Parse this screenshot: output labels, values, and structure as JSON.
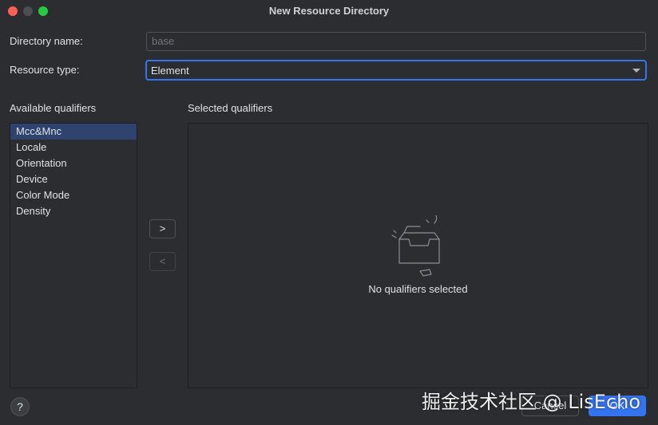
{
  "window": {
    "title": "New Resource Directory"
  },
  "form": {
    "directory_name_label": "Directory name:",
    "directory_name_value": "base",
    "resource_type_label": "Resource type:",
    "resource_type_value": "Element"
  },
  "available": {
    "header": "Available qualifiers",
    "items": [
      "Mcc&Mnc",
      "Locale",
      "Orientation",
      "Device",
      "Color Mode",
      "Density"
    ],
    "selected_index": 0
  },
  "selected": {
    "header": "Selected qualifiers",
    "empty_text": "No qualifiers selected"
  },
  "transfer": {
    "add_label": ">",
    "remove_label": "<"
  },
  "footer": {
    "help_label": "?",
    "cancel_label": "Cancel",
    "ok_label": "OK"
  },
  "watermark": "掘金技术社区 @ LisEcho",
  "colors": {
    "accent": "#3574f0",
    "background": "#2b2d30",
    "selection": "#2e436e"
  }
}
